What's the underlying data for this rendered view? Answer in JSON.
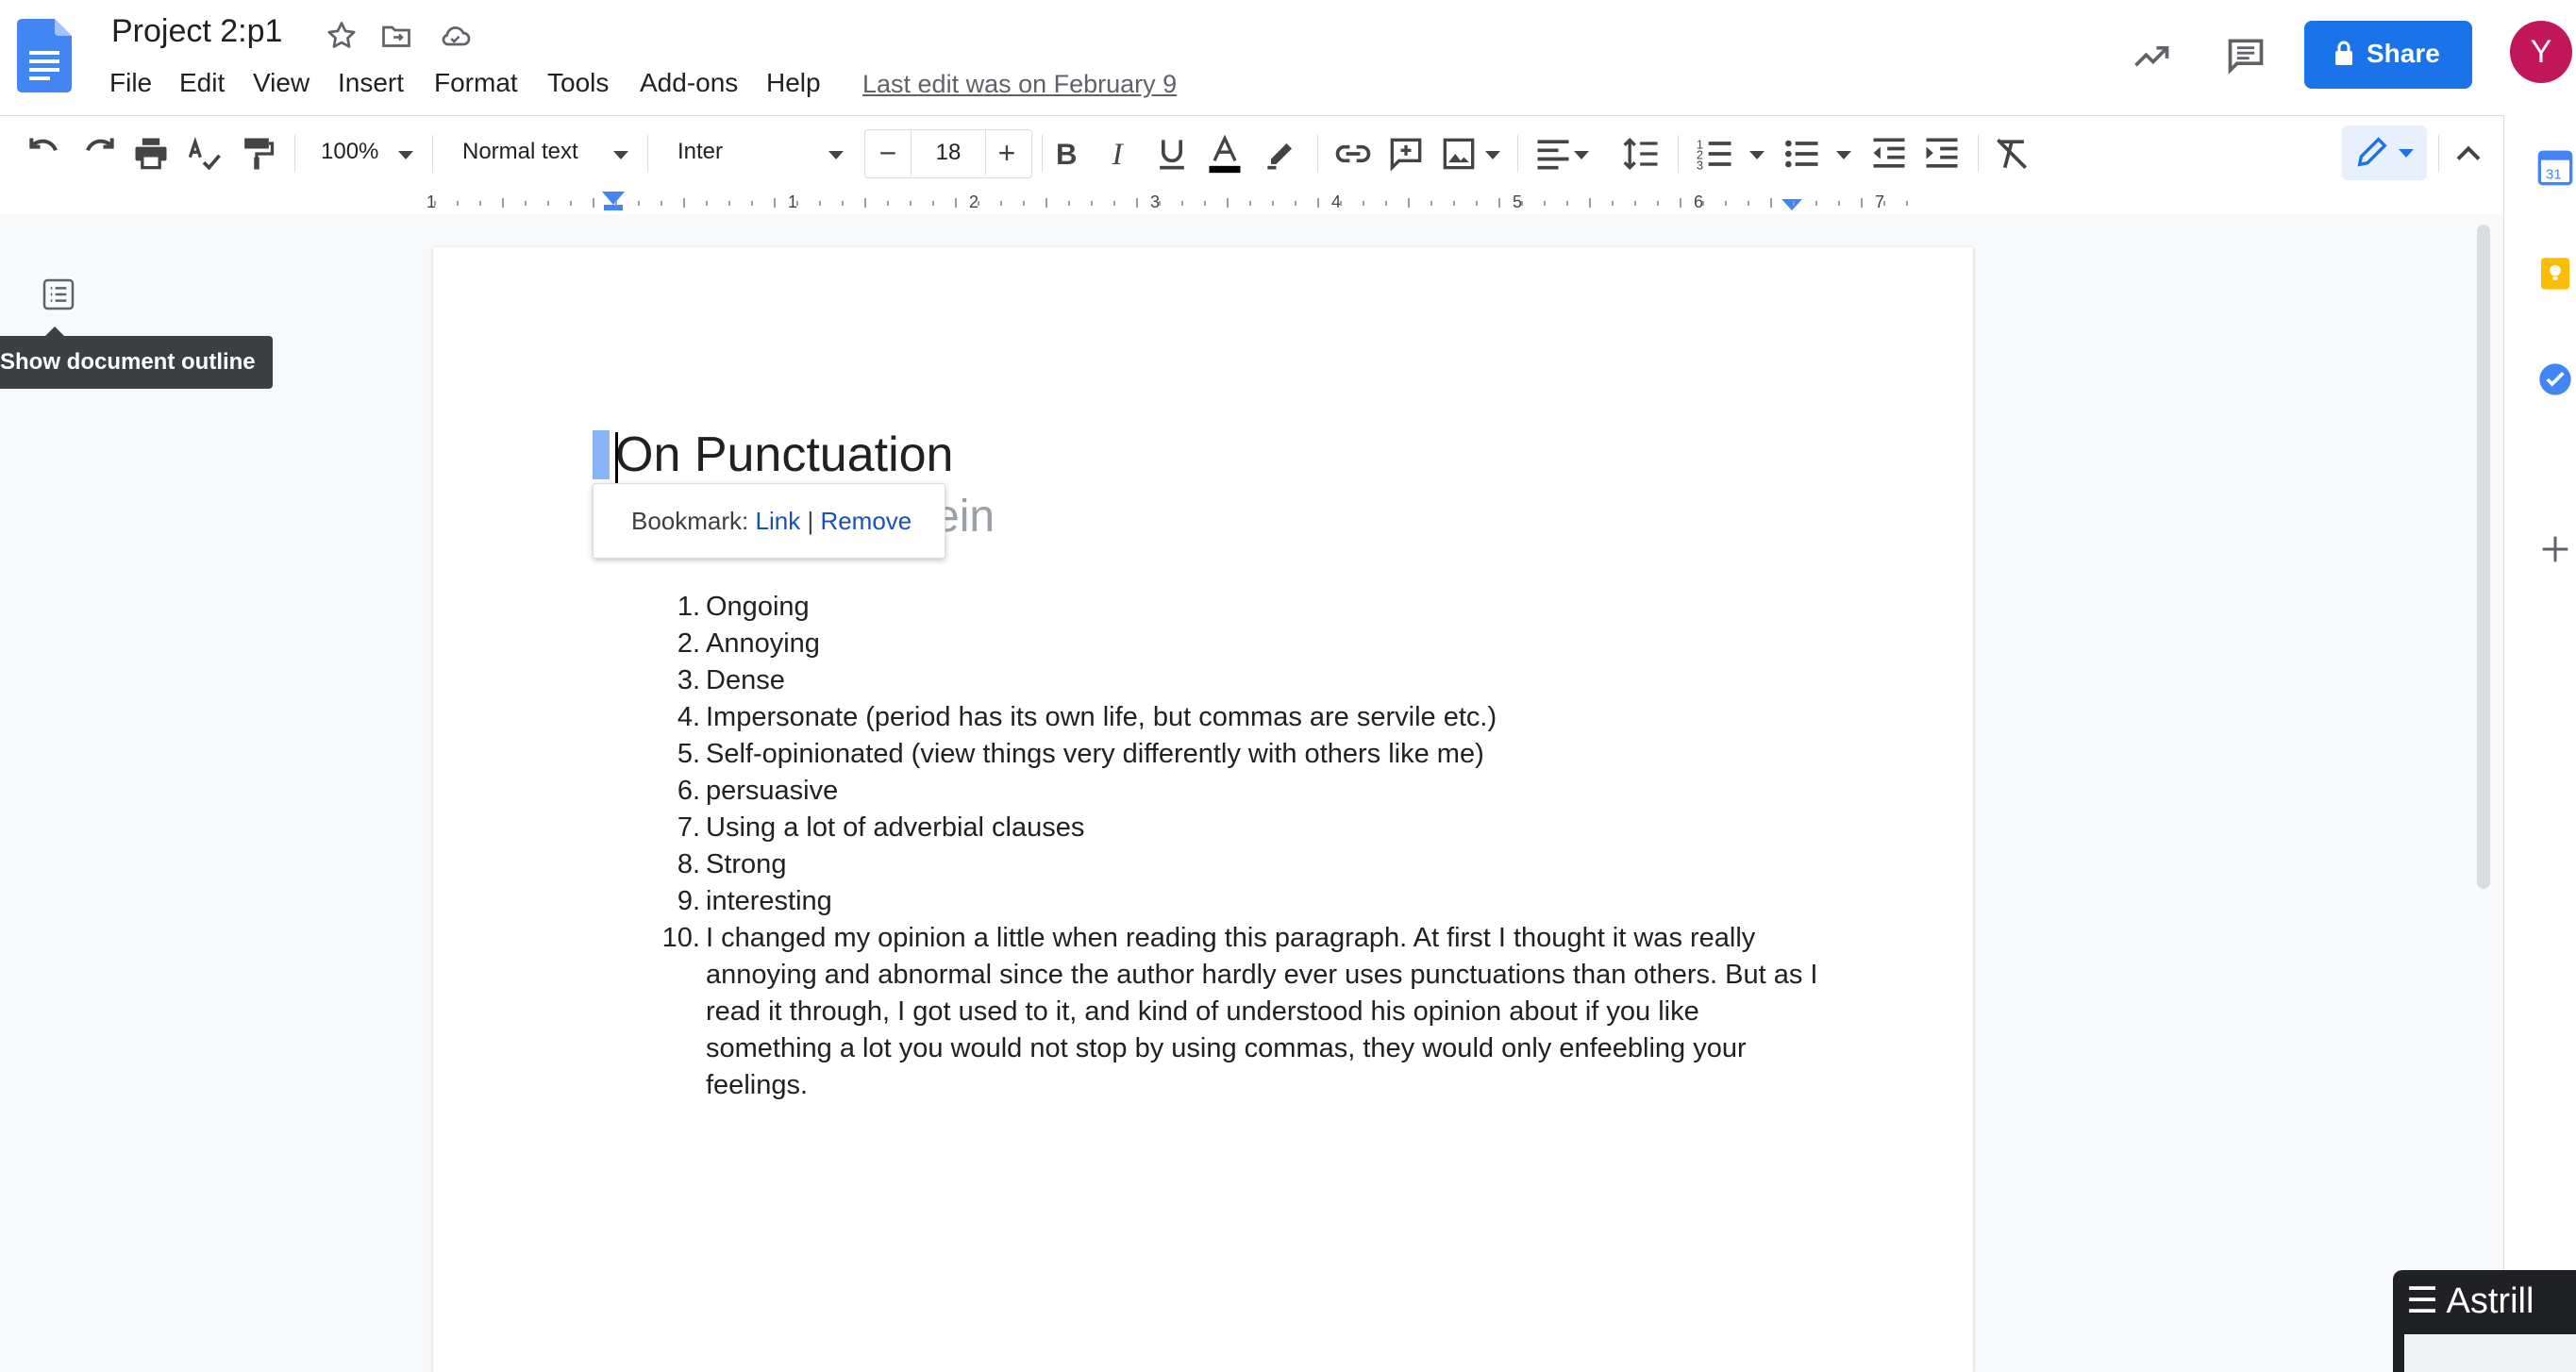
{
  "header": {
    "title": "Project 2:p1",
    "menus": [
      "File",
      "Edit",
      "View",
      "Insert",
      "Format",
      "Tools",
      "Add-ons",
      "Help"
    ],
    "last_edit": "Last edit was on February 9",
    "share_label": "Share",
    "avatar_letter": "Y"
  },
  "toolbar": {
    "zoom": "100%",
    "style": "Normal text",
    "font": "Inter",
    "font_size": "18",
    "minus": "−",
    "plus": "+"
  },
  "ruler": {
    "labels": [
      "1",
      "1",
      "2",
      "3",
      "4",
      "5",
      "6",
      "7"
    ]
  },
  "left_panel": {
    "tooltip": "Show document outline"
  },
  "document": {
    "heading": "On Punctuation",
    "subtitle_partial": "ein",
    "bookmark_popup": {
      "prefix": "Bookmark:",
      "link": "Link",
      "separator": "|",
      "remove": "Remove"
    },
    "list": [
      {
        "n": "1.",
        "text": "Ongoing"
      },
      {
        "n": "2.",
        "text": "Annoying"
      },
      {
        "n": "3.",
        "text": "Dense"
      },
      {
        "n": "4.",
        "text": "Impersonate (period has its own life, but commas are servile etc.)"
      },
      {
        "n": "5.",
        "text": "Self-opinionated (view things very differently with others like me)"
      },
      {
        "n": "6.",
        "text": "persuasive"
      },
      {
        "n": "7.",
        "text": "Using a lot of adverbial clauses"
      },
      {
        "n": "8.",
        "text": "Strong"
      },
      {
        "n": "9.",
        "text": "interesting"
      },
      {
        "n": "10.",
        "text": "I changed my opinion a little when reading this paragraph. At first I thought it was really annoying and abnormal since the author hardly ever uses punctuations than others. But as I read it through, I got used to it, and kind of understood his opinion about if you like something a lot you would not stop by using commas, they would only enfeebling your feelings."
      }
    ]
  },
  "side_panel": {
    "calendar_day": "31",
    "add": "+"
  },
  "astrill": {
    "label": "☰ Astrill"
  },
  "colors": {
    "accent": "#1a73e8",
    "avatar": "#c2185b",
    "link": "#1a4fb3",
    "tooltip_bg": "#3c4043"
  }
}
